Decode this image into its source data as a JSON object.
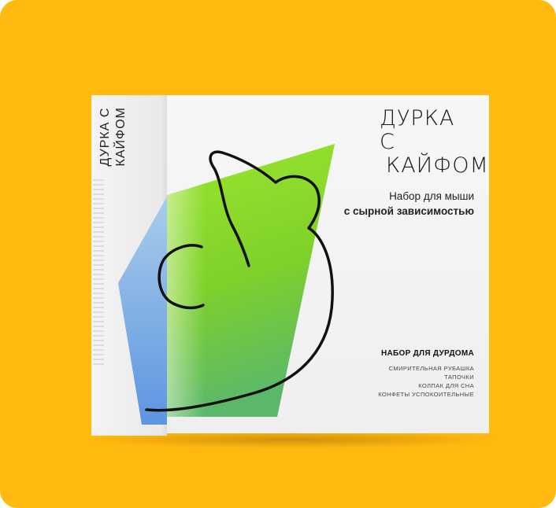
{
  "background_color": "#FFB90F",
  "box": {
    "side_title_line1": "ДУРКА С",
    "side_title_line2": "КАЙФОМ",
    "brand_line1": "ДУРКА С",
    "brand_line2": "КАЙФОМ",
    "tagline_line1": "Набор для мыши",
    "tagline_line2": "с сырной зависимостью",
    "kit_title": "НАБОР ДЛЯ ДУРДОМА",
    "kit_items": [
      "СМИРИТЕЛЬНАЯ РУБАШКА",
      "ТАПОЧКИ",
      "КОЛПАК ДЛЯ СНА",
      "КОНФЕТЫ УСПОКОИТЕЛЬНЫЕ"
    ],
    "accent_green": "#8EE02A",
    "accent_blue": "#6FA8E8",
    "mouse_icon": "mouse-outline-icon"
  }
}
